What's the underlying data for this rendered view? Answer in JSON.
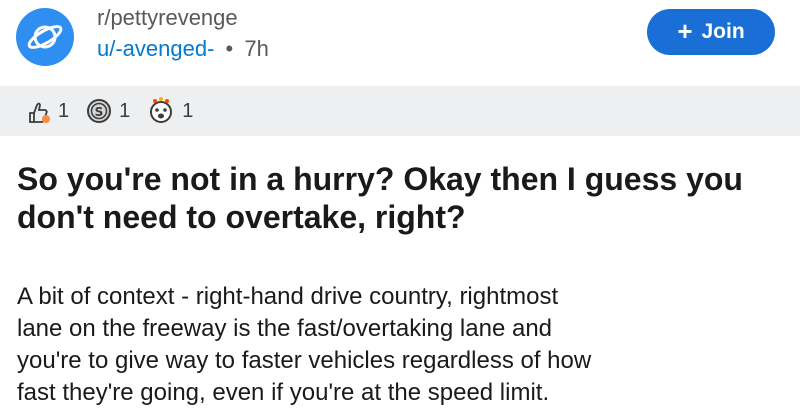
{
  "post": {
    "subreddit": "r/pettyrevenge",
    "username": "u/-avenged-",
    "separator": "•",
    "age": "7h",
    "join_label": "Join",
    "join_icon": "+",
    "awards": [
      {
        "icon": "wholesome-award-icon",
        "count": "1"
      },
      {
        "icon": "silver-award-icon",
        "count": "1"
      },
      {
        "icon": "hugz-award-icon",
        "count": "1"
      }
    ],
    "title": "So you're not in a hurry? Okay then I guess you don't need to overtake, right?",
    "body_lines": [
      "A bit of context - right-hand drive country, rightmost",
      "lane on the freeway is the fast/overtaking lane and",
      "you're to give way to faster vehicles regardless of how",
      "fast they're going, even if you're at the speed limit."
    ]
  },
  "colors": {
    "accent": "#1a6fd6",
    "username": "#0079d3",
    "awards_bar": "#edeff1",
    "avatar": "#2e8ff0"
  }
}
